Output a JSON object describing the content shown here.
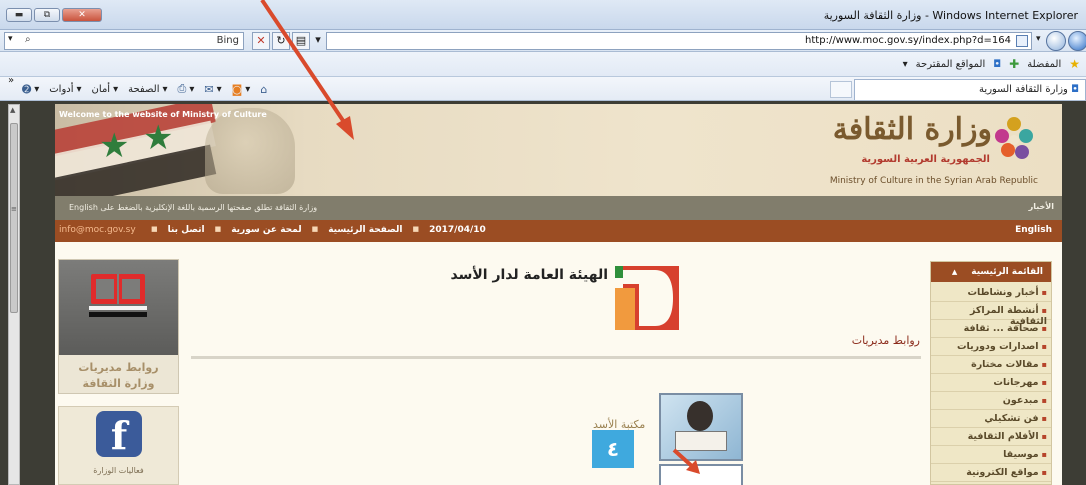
{
  "window": {
    "title": "وزارة الثقافة السورية - Windows Internet Explorer",
    "buttons": [
      "▭",
      "⧉",
      "▬"
    ]
  },
  "addressbar": {
    "search_engine": "Bing",
    "url": "http://www.moc.gov.sy/index.php?d=164"
  },
  "favorites": {
    "favorites_label": "المفضلة",
    "suggested_sites": "المواقع المقترحة"
  },
  "tab": {
    "title": "وزارة الثقافة السورية"
  },
  "commandbar": {
    "page": "الصفحة",
    "safety": "أمان",
    "tools": "أدوات",
    "chevron": "»"
  },
  "site": {
    "welcome": "Welcome to the website of Ministry of Culture",
    "logo_ar": "وزارة الثقافة",
    "logo_sub": "الجمهورية العربية السورية",
    "logo_en": "Ministry of Culture in the Syrian Arab Republic",
    "news_label": "الأخبار",
    "news_text": "وزارة الثقافة تطلق صفحتها الرسمية باللغة الإنكليزية بالضغط على English",
    "nav": {
      "english": "English",
      "date": "2017/04/10",
      "home": "الصفحة الرئيسية",
      "about": "لمحة عن سورية",
      "contact": "اتصل بنا",
      "email": "info@moc.gov.sy"
    },
    "left": {
      "directorates_line1": "روابط مديريات",
      "directorates_line2": "وزارة الثقافة",
      "ministry_events": "فعاليات الوزارة"
    },
    "center": {
      "org_title": "الهيئة العامة لدار الأسد",
      "links_title": "روابط مديريات",
      "library_label": "مكتبة الأسد",
      "badge": "٤"
    },
    "menu": {
      "header": "القائمة الرئيسية",
      "items": [
        "أخبار ونشاطات",
        "أنشطة المراكز الثقافية",
        "صحافة ... ثقافة",
        "اصدارات ودوريات",
        "مقالات مختارة",
        "مهرجانات",
        "مبدعون",
        "فن تشكيلي",
        "الأفلام الثقافية",
        "موسيقا",
        "مواقع الكترونية"
      ]
    }
  },
  "colors": {
    "nav_bar": "#9b4d23",
    "news_bar": "#817d6c",
    "annotation_arrow": "#d94a2c",
    "badge": "#3fa9de"
  }
}
